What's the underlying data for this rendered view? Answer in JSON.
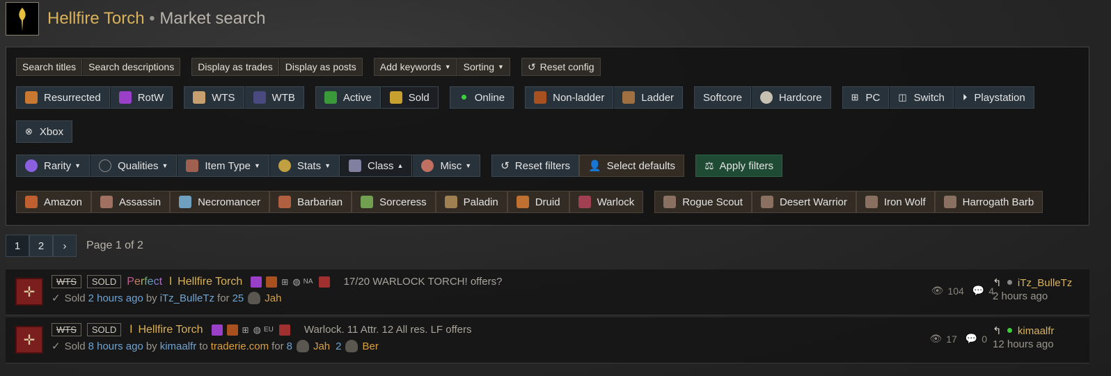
{
  "header": {
    "title": "Hellfire Torch",
    "separator": "•",
    "subtitle": "Market search"
  },
  "toolbar": {
    "search_prefix_1": "Search",
    "search_titles": "titles",
    "search_prefix_2": "Search",
    "search_descriptions": "descriptions",
    "display_prefix_1": "Display as",
    "display_trades": "trades",
    "display_prefix_2": "Display as",
    "display_posts": "posts",
    "add_keywords": "Add keywords",
    "sorting": "Sorting",
    "reset_config": "Reset config"
  },
  "toggles": {
    "resurrected": "Resurrected",
    "rotw": "RotW",
    "wts": "WTS",
    "wtb": "WTB",
    "active": "Active",
    "sold": "Sold",
    "online": "Online",
    "non_ladder": "Non-ladder",
    "ladder": "Ladder",
    "softcore": "Softcore",
    "hardcore": "Hardcore",
    "pc": "PC",
    "switch": "Switch",
    "playstation": "Playstation",
    "xbox": "Xbox"
  },
  "filters": {
    "rarity": "Rarity",
    "qualities": "Qualities",
    "item_type": "Item Type",
    "stats": "Stats",
    "class": "Class",
    "misc": "Misc",
    "reset_filters": "Reset filters",
    "select_defaults": "Select defaults",
    "apply_filters": "Apply filters"
  },
  "classes": [
    "Amazon",
    "Assassin",
    "Necromancer",
    "Barbarian",
    "Sorceress",
    "Paladin",
    "Druid",
    "Warlock"
  ],
  "mercs": [
    "Rogue Scout",
    "Desert Warrior",
    "Iron Wolf",
    "Harrogath Barb"
  ],
  "pager": {
    "page1": "1",
    "page2": "2",
    "label": "Page 1 of 2"
  },
  "listings": [
    {
      "tag1": "WTS",
      "tag2": "SOLD",
      "quality": "Perfect",
      "item": "Hellfire Torch",
      "region": "NA",
      "description": "17/20 WARLOCK TORCH! offers?",
      "sold": "Sold",
      "time": "2 hours ago",
      "by": "by",
      "user": "iTz_BulleTz",
      "for": "for",
      "price": "25",
      "rune": "Jah",
      "views": "104",
      "comments": "4",
      "ago": "2 hours ago"
    },
    {
      "tag1": "WTS",
      "tag2": "SOLD",
      "item": "Hellfire Torch",
      "region": "EU",
      "description": "Warlock. 11 Attr. 12 All res. LF offers",
      "sold": "Sold",
      "time": "8 hours ago",
      "by": "by",
      "user": "kimaalfr",
      "to": "to",
      "site": "traderie.com",
      "for": "for",
      "price1": "8",
      "rune1": "Jah",
      "price2": "2",
      "rune2": "Ber",
      "views": "17",
      "comments": "0",
      "ago": "12 hours ago"
    }
  ]
}
